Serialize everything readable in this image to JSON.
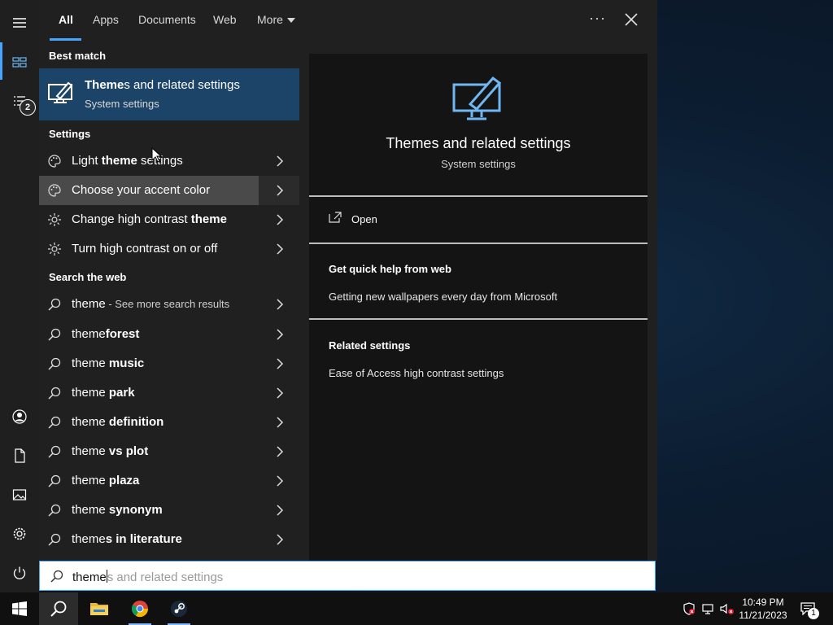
{
  "tabs": [
    {
      "label": "All"
    },
    {
      "label": "Apps"
    },
    {
      "label": "Documents"
    },
    {
      "label": "Web"
    },
    {
      "label": "More"
    }
  ],
  "left_rail": {
    "badge_count": "2"
  },
  "best_match": {
    "heading": "Best match",
    "title": "Themes and related settings",
    "title_bold": "Theme",
    "title_rest": "s and related settings",
    "subtitle": "System settings"
  },
  "settings_section": {
    "heading": "Settings",
    "items": [
      {
        "pre": "Light ",
        "bold": "theme",
        "post": " settings",
        "icon": "palette-icon"
      },
      {
        "pre": "Choose your accent color",
        "bold": "",
        "post": "",
        "icon": "palette-icon"
      },
      {
        "pre": "Change high contrast ",
        "bold": "theme",
        "post": "",
        "icon": "sun-icon"
      },
      {
        "pre": "Turn high contrast on or off",
        "bold": "",
        "post": "",
        "icon": "sun-icon"
      }
    ]
  },
  "web_section": {
    "heading": "Search the web",
    "first": {
      "text": "theme",
      "sub": " - See more search results"
    },
    "items": [
      {
        "pre": "theme",
        "bold": "forest"
      },
      {
        "pre": "theme ",
        "bold": "music"
      },
      {
        "pre": "theme ",
        "bold": "park"
      },
      {
        "pre": "theme ",
        "bold": "definition"
      },
      {
        "pre": "theme ",
        "bold": "vs plot"
      },
      {
        "pre": "theme ",
        "bold": "plaza"
      },
      {
        "pre": "theme ",
        "bold": "synonym"
      },
      {
        "pre": "theme",
        "bold": "s in literature"
      }
    ]
  },
  "details": {
    "title": "Themes and related settings",
    "subtitle": "System settings",
    "open_label": "Open",
    "quick_help_heading": "Get quick help from web",
    "quick_help_link": "Getting new wallpapers every day from Microsoft",
    "related_heading": "Related settings",
    "related_link": "Ease of Access high contrast settings"
  },
  "search": {
    "typed": "theme",
    "ghost": "s and related settings"
  },
  "taskbar": {
    "time": "10:49 PM",
    "date": "11/21/2023",
    "notification_count": "1"
  },
  "colors": {
    "accent": "#4aa3ff",
    "best_match_bg": "#1c4468",
    "icon_blue": "#6fb6f2"
  }
}
